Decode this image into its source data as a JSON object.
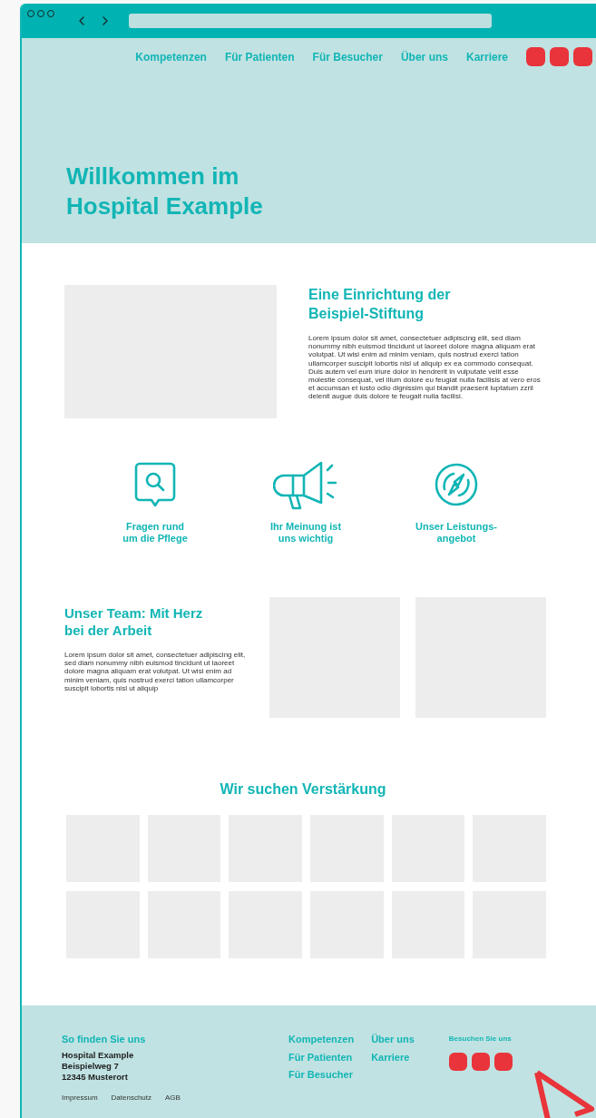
{
  "nav": {
    "links": [
      "Kompetenzen",
      "Für Patienten",
      "Für Besucher",
      "Über uns",
      "Karriere"
    ]
  },
  "hero": {
    "title_lines": [
      "Willkommen im",
      "Hospital Example"
    ]
  },
  "foundation": {
    "heading_lines": [
      "Eine Einrichtung der",
      "Beispiel-Stiftung"
    ],
    "body": "Lorem ipsum dolor sit amet, consectetuer adipiscing elit, sed diam nonummy nibh euismod tincidunt ut laoreet dolore magna aliquam erat volutpat. Ut wisi enim ad minim veniam, quis nostrud exerci tation ullamcorper suscipit lobortis nisl ut aliquip ex ea commodo consequat. Duis autem vel eum iriure dolor in hendrerit in vulputate velit esse molestie consequat, vel illum dolore eu feugiat nulla facilisis at vero eros et accumsan et iusto odio dignissim qui blandit praesent luptatum zzril delenit augue duis dolore te feugait nulla facilisi."
  },
  "features": [
    {
      "kind": "chat-search",
      "label_lines": [
        "Fragen rund",
        "um die Pflege"
      ]
    },
    {
      "kind": "megaphone",
      "label_lines": [
        "Ihr Meinung ist",
        "uns wichtig"
      ]
    },
    {
      "kind": "compass",
      "label_lines": [
        "Unser Leistungs-",
        "angebot"
      ]
    }
  ],
  "team": {
    "heading_lines": [
      "Unser Team: Mit Herz",
      "bei der Arbeit"
    ],
    "body": "Lorem ipsum dolor sit amet, consectetuer adipiscing elit, sed diam nonummy nibh euismod tincidunt ut laoreet dolore magna aliquam erat volutpat. Ut wisi enim ad minim veniam, quis nostrud exerci tation ullamcorper suscipit lobortis nisl ut aliquip"
  },
  "jobs": {
    "heading": "Wir suchen Verstärkung"
  },
  "footer": {
    "find_heading": "So finden Sie uns",
    "address_lines": [
      "Hospital Example",
      "Beispielweg 7",
      "12345 Musterort"
    ],
    "legal_links": [
      "Impressum",
      "Datenschutz",
      "AGB"
    ],
    "nav_columns": [
      [
        "Kompetenzen",
        "Für Patienten",
        "Für Besucher"
      ],
      [
        "Über uns",
        "Karriere"
      ]
    ],
    "social_heading": "Besuchen Sie uns"
  }
}
